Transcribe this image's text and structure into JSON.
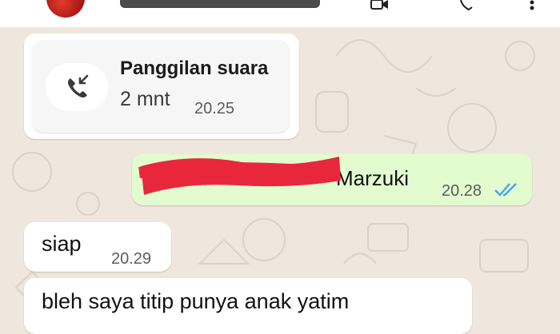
{
  "theme": {
    "wallpaper_color": "#efe7dd",
    "incoming_bubble_color": "#ffffff",
    "outgoing_bubble_color": "#e2fbcf",
    "read_tick_color": "#4aa3e0",
    "redaction_color": "#e8273c",
    "avatar_color": "#c8231c"
  },
  "header": {
    "icons": [
      "video-call-icon",
      "voice-call-icon",
      "more-icon"
    ]
  },
  "messages": {
    "call": {
      "icon": "incoming-call-icon",
      "title": "Panggilan suara",
      "duration": "2 mnt",
      "time": "20.25"
    },
    "outgoing": {
      "text_visible": "Marzuki",
      "time": "20.28",
      "status_icon": "double-check-read-icon"
    },
    "incoming_1": {
      "text": "siap",
      "time": "20.29"
    },
    "incoming_2": {
      "text": "bleh saya titip punya anak yatim"
    }
  }
}
